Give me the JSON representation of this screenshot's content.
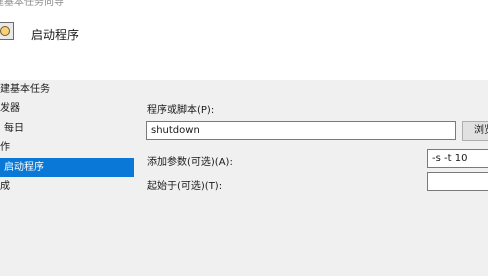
{
  "window": {
    "title": "建基本任务向导"
  },
  "header": {
    "icon": "clock-icon",
    "title": "启动程序"
  },
  "steps": [
    {
      "label": "建基本任务",
      "selected": false
    },
    {
      "label": "发器",
      "selected": false
    },
    {
      "label": "每日",
      "selected": false
    },
    {
      "label": "作",
      "selected": false
    },
    {
      "label": "启动程序",
      "selected": true
    },
    {
      "label": "成",
      "selected": false
    }
  ],
  "form": {
    "program_label": "程序或脚本(P):",
    "program_value": "shutdown",
    "browse_label": "浏览(R)...",
    "args_label": "添加参数(可选)(A):",
    "args_value": "-s -t 10",
    "startin_label": "起始于(可选)(T):",
    "startin_value": ""
  },
  "colors": {
    "selected_bg": "#0a78d7",
    "panel_bg": "#f0f0f0"
  }
}
